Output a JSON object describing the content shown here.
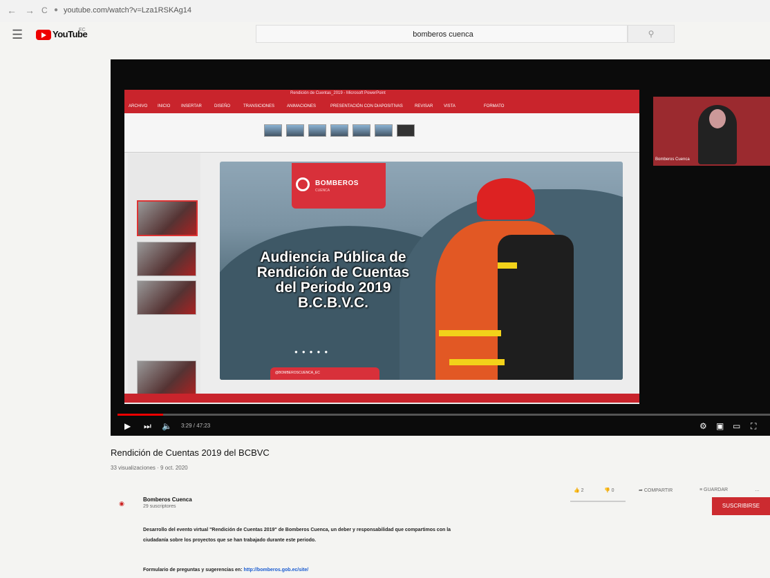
{
  "browser": {
    "url": "youtube.com/watch?v=Lza1RSKAg14",
    "back": "←",
    "forward": "→",
    "reload": "C",
    "lock": "🔒"
  },
  "youtube": {
    "wordmark": "YouTube",
    "country": "EC",
    "menu_icon": "☰"
  },
  "search": {
    "query": "bomberos cuenca",
    "button_icon": "search-icon"
  },
  "presentation": {
    "window_title": "Rendición de Cuentas_2019 - Microsoft PowerPoint",
    "tabs": [
      "ARCHIVO",
      "INICIO",
      "INSERTAR",
      "DISEÑO",
      "TRANSICIONES",
      "ANIMACIONES",
      "PRESENTACIÓN CON DIAPOSITIVAS",
      "REVISAR",
      "VISTA",
      "FORMATO"
    ],
    "brand": "BOMBEROS",
    "brand_sub": "CUENCA",
    "slide_title": "Audiencia Pública de\nRendición de Cuentas\ndel Periodo 2019\nB.C.B.V.C.",
    "footer": "@BOMBEROSCUENCA_EC",
    "webcam_label": "Bomberos Cuenca"
  },
  "player": {
    "time": "3:29 / 47:23",
    "progress": 0.07
  },
  "video": {
    "title": "Rendición de Cuentas 2019 del BCBVC",
    "meta": "33 visualizaciones · 9 oct. 2020",
    "likes": "2",
    "dislikes": "0",
    "share": "COMPARTIR",
    "save": "GUARDAR",
    "more": "…"
  },
  "channel": {
    "name": "Bomberos Cuenca",
    "subscribers": "29 suscriptores",
    "subscribe": "SUSCRIBIRSE"
  },
  "description": {
    "text": "Desarrollo del evento virtual \"Rendición de Cuentas 2019\" de Bomberos Cuenca, un deber y responsabilidad que compartimos con la ciudadanía sobre los proyectos que se han trabajado durante este periodo.",
    "form_label": "Formulario de preguntas y sugerencias en:",
    "form_link": "http://bomberos.gob.ec/site/"
  },
  "colors": {
    "brand_red": "#d8303a",
    "yt_red": "#ff0000"
  }
}
